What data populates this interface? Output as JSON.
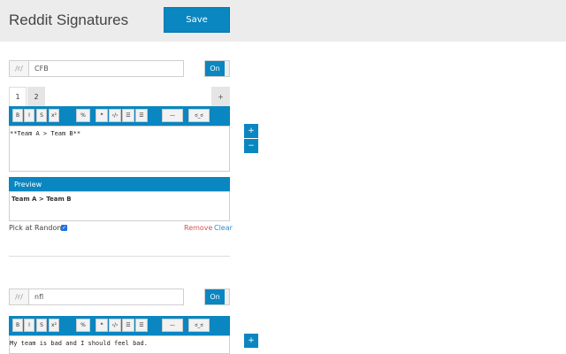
{
  "header": {
    "title": "Reddit Signatures",
    "save_label": "Save"
  },
  "colors": {
    "accent": "#0a86c0",
    "remove": "#d9534f",
    "clear": "#2a8ed4"
  },
  "toolbar_buttons": [
    {
      "icon": "bold-icon",
      "label": "B"
    },
    {
      "icon": "italic-icon",
      "label": "I"
    },
    {
      "icon": "strikethrough-icon",
      "label": "S"
    },
    {
      "icon": "superscript-icon",
      "label": "x²"
    },
    {
      "icon": "link-icon",
      "label": "%"
    },
    {
      "icon": "quote-icon",
      "label": "❝"
    },
    {
      "icon": "code-icon",
      "label": "‹/›"
    },
    {
      "icon": "bullet-list-icon",
      "label": "☰"
    },
    {
      "icon": "numbered-list-icon",
      "label": "☰"
    },
    {
      "icon": "horizontal-rule-icon",
      "label": "—"
    },
    {
      "icon": "disapproval-face-icon",
      "label": "ಠ_ಠ"
    }
  ],
  "signature_1": {
    "prefix": "/r/",
    "subreddit": "CFB",
    "toggle": "On",
    "tabs": [
      "1",
      "2"
    ],
    "add_tab": "+",
    "editor_text": "**Team A > Team B**",
    "preview_label": "Preview",
    "preview_text": "Team A > Team B",
    "pick_random_label": "Pick at Random",
    "pick_random_checked": true,
    "remove_label": "Remove",
    "clear_label": "Clear",
    "add_button": "+",
    "remove_button": "−"
  },
  "signature_2": {
    "prefix": "/r/",
    "subreddit": "nfl",
    "toggle": "On",
    "editor_text": "My team is bad and I should feel bad.",
    "add_button": "+"
  }
}
